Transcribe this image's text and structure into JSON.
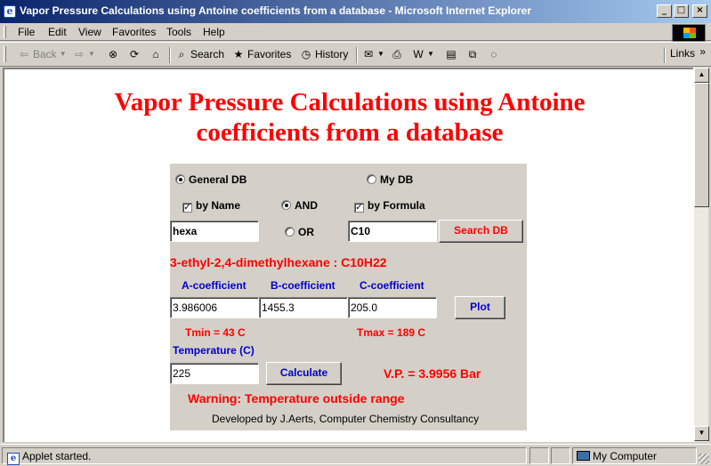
{
  "window": {
    "title": "Vapor Pressure Calculations using Antoine coefficients from a database - Microsoft Internet Explorer",
    "minimize_glyph": "_",
    "maximize_glyph": "□",
    "close_glyph": "×"
  },
  "menubar": {
    "items": [
      "File",
      "Edit",
      "View",
      "Favorites",
      "Tools",
      "Help"
    ]
  },
  "toolbar": {
    "back_label": "Back",
    "search_label": "Search",
    "favorites_label": "Favorites",
    "history_label": "History",
    "links_label": "Links",
    "links_chevron": "»"
  },
  "page": {
    "title_line1": "Vapor Pressure Calculations using Antoine",
    "title_line2": "coefficients from a database"
  },
  "applet": {
    "general_db_label": "General DB",
    "general_db_selected": true,
    "my_db_label": "My DB",
    "my_db_selected": false,
    "by_name_label": "by Name",
    "by_name_checked": true,
    "and_label": "AND",
    "and_selected": true,
    "or_label": "OR",
    "or_selected": false,
    "by_formula_label": "by Formula",
    "by_formula_checked": true,
    "name_value": "hexa",
    "formula_value": "C10",
    "search_button": "Search DB",
    "compound": "3-ethyl-2,4-dimethylhexane : C10H22",
    "a_header": "A-coefficient",
    "b_header": "B-coefficient",
    "c_header": "C-coefficient",
    "a_value": "3.986006",
    "b_value": "1455.3",
    "c_value": "205.0",
    "plot_button": "Plot",
    "tmin": "Tmin = 43 C",
    "tmax": "Tmax = 189 C",
    "temperature_label": "Temperature (C)",
    "temperature_value": "225",
    "calculate_button": "Calculate",
    "vp_result": "V.P. = 3.9956 Bar",
    "warning": "Warning: Temperature outside range",
    "credit": "Developed by J.Aerts, Computer Chemistry Consultancy"
  },
  "statusbar": {
    "status_text": "Applet started.",
    "zone_text": "My Computer"
  },
  "colors": {
    "title_red": "#ff0000",
    "label_blue": "#0000cc",
    "titlebar_start": "#0a246a",
    "titlebar_end": "#a6caf0",
    "chrome": "#d4d0c8"
  }
}
